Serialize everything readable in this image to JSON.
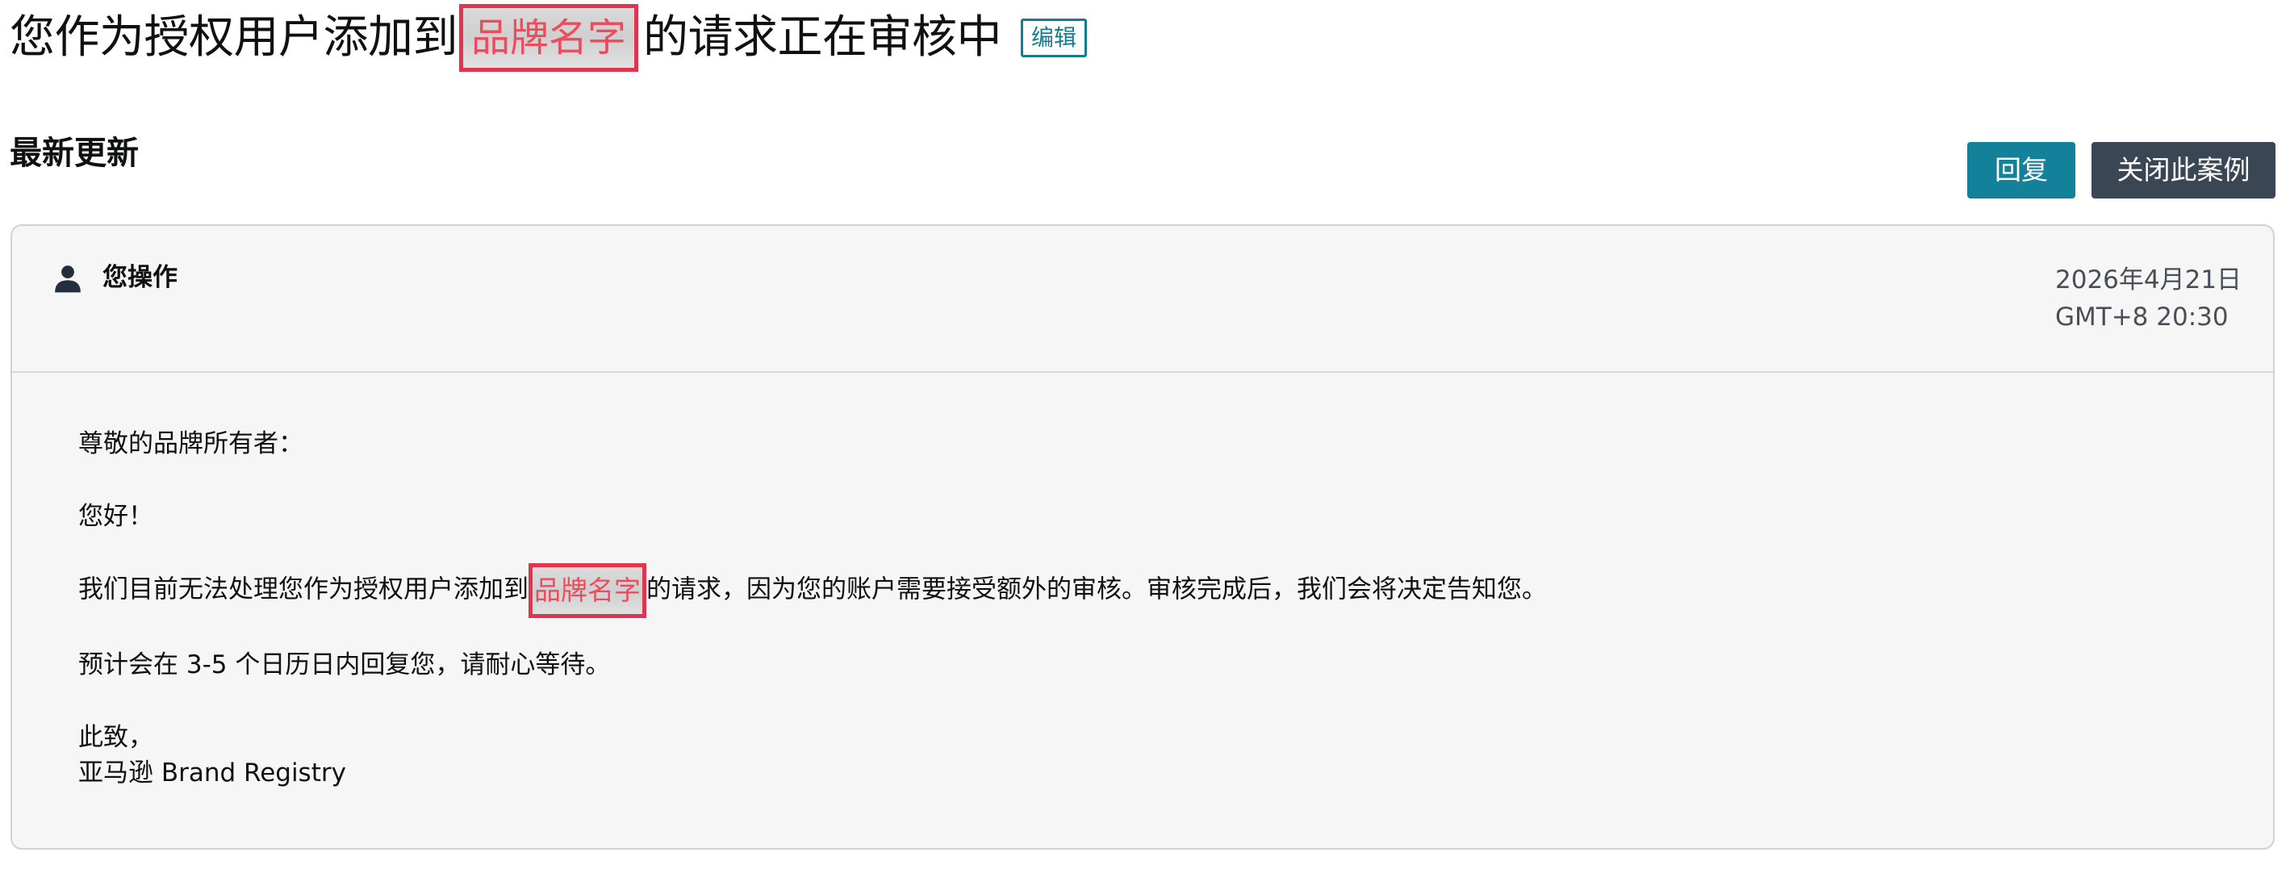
{
  "header": {
    "title_prefix": "您作为授权用户添加到",
    "brand_name": "品牌名字",
    "title_suffix": "的请求正在审核中",
    "edit_label": "编辑"
  },
  "section": {
    "heading": "最新更新"
  },
  "actions": {
    "reply_label": "回复",
    "close_case_label": "关闭此案例"
  },
  "message": {
    "actor_icon": "user-icon",
    "actor_label": "您操作",
    "date": "2026年4月21日",
    "time": "GMT+8 20:30",
    "greeting": "尊敬的品牌所有者：",
    "hello": "您好！",
    "body_prefix": "我们目前无法处理您作为授权用户添加到",
    "body_brand": "品牌名字",
    "body_suffix": "的请求，因为您的账户需要接受额外的审核。审核完成后，我们会将决定告知您。",
    "eta": "预计会在 3-5 个日历日内回复您，请耐心等待。",
    "closing": "此致，",
    "signature": "亚马逊 Brand Registry"
  },
  "colors": {
    "highlight_border": "#e2334f",
    "brand_text": "#ef4b5d",
    "reply_button": "#14819a",
    "close_button": "#3b4654",
    "edit_badge": "#147c8f"
  }
}
